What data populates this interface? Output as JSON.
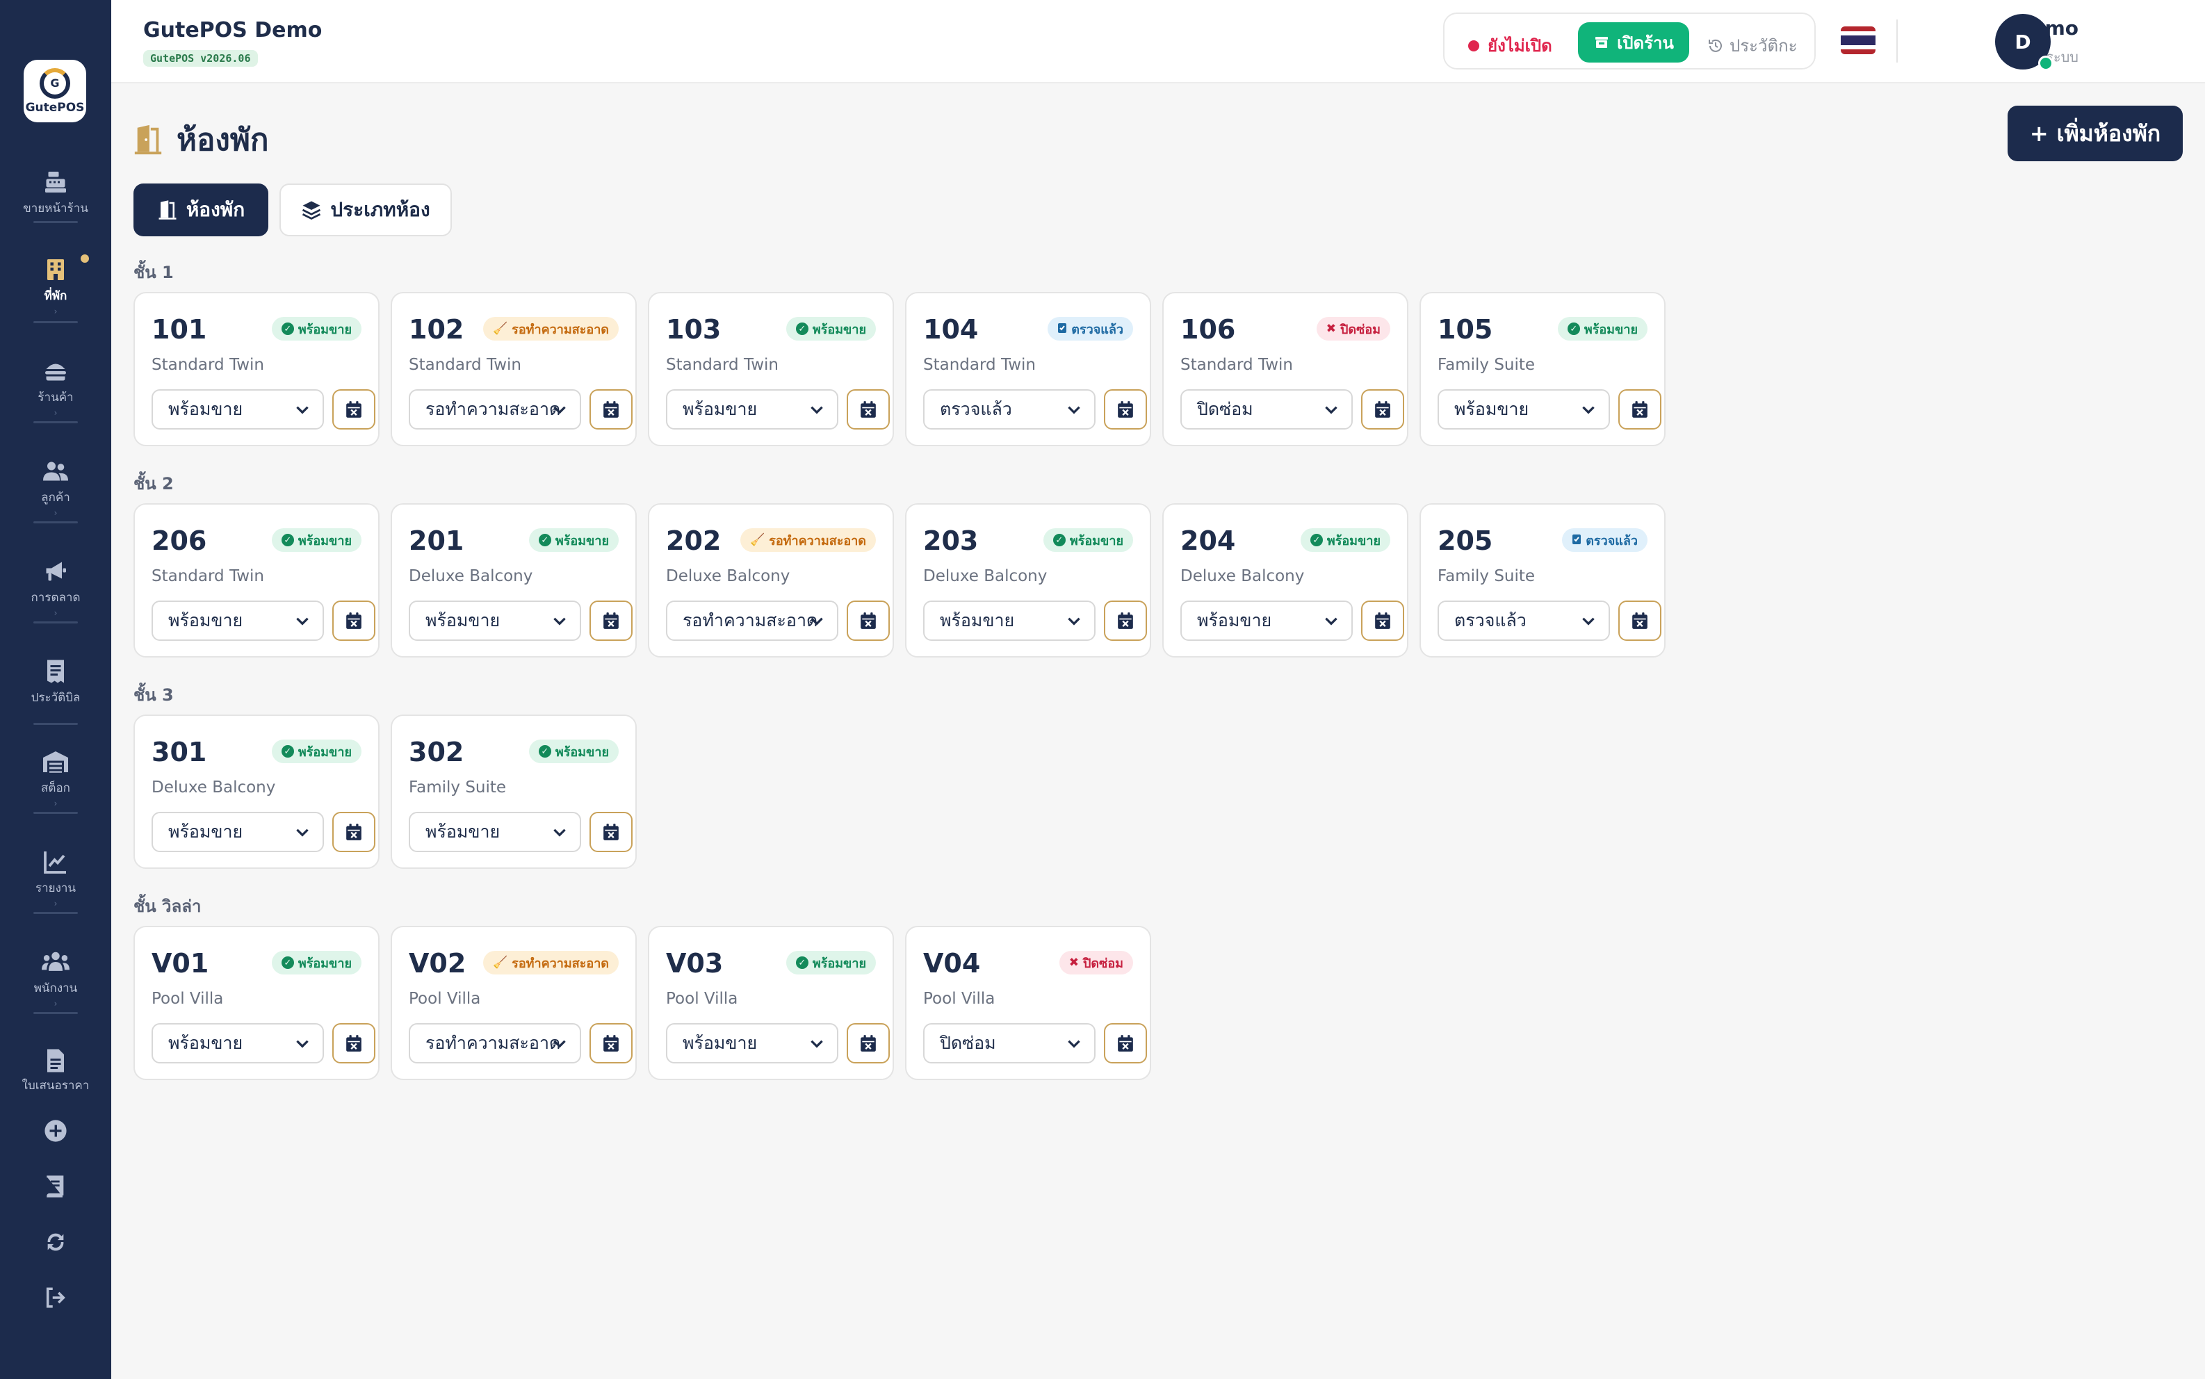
{
  "app": {
    "title": "GutePOS Demo",
    "version": "GutePOS v2026.06",
    "logo_text": "GutePOS"
  },
  "sidebar": {
    "items": [
      {
        "label": "ขายหน้าร้าน",
        "icon": "cash-register-icon",
        "active": false
      },
      {
        "label": "ที่พัก",
        "icon": "building-icon",
        "active": true
      },
      {
        "label": "ร้านค้า",
        "icon": "burger-icon",
        "active": false
      },
      {
        "label": "ลูกค้า",
        "icon": "users-icon",
        "active": false
      },
      {
        "label": "การตลาด",
        "icon": "megaphone-icon",
        "active": false
      },
      {
        "label": "ประวัติบิล",
        "icon": "receipt-icon",
        "active": false
      },
      {
        "label": "สต็อก",
        "icon": "warehouse-icon",
        "active": false
      },
      {
        "label": "รายงาน",
        "icon": "chart-line-icon",
        "active": false
      },
      {
        "label": "พนักงาน",
        "icon": "staff-icon",
        "active": false
      },
      {
        "label": "ใบเสนอราคา",
        "icon": "document-icon",
        "active": false
      }
    ],
    "bottom": [
      "plus-circle-icon",
      "book-icon",
      "sync-icon",
      "logout-icon"
    ]
  },
  "header": {
    "shop_status": "ยังไม่เปิด",
    "open_button": "เปิดร้าน",
    "history_button": "ประวัติกะ",
    "user_name": "Demo",
    "user_role": "ผู้ดูแลระบบ",
    "avatar_initial": "D"
  },
  "page": {
    "title": "ห้องพัก",
    "add_button": "เพิ่มห้องพัก",
    "tabs": [
      {
        "label": "ห้องพัก",
        "active": true
      },
      {
        "label": "ประเภทห้อง",
        "active": false
      }
    ]
  },
  "floors": [
    {
      "label": "ชั้น 1",
      "rooms": [
        {
          "number": "101",
          "type": "Standard Twin",
          "status": "พร้อมขาย",
          "kind": "ok",
          "select": "พร้อมขาย"
        },
        {
          "number": "102",
          "type": "Standard Twin",
          "status": "รอทำความสะอาด",
          "kind": "clean",
          "select": "รอทำความสะอาด"
        },
        {
          "number": "103",
          "type": "Standard Twin",
          "status": "พร้อมขาย",
          "kind": "ok",
          "select": "พร้อมขาย"
        },
        {
          "number": "104",
          "type": "Standard Twin",
          "status": "ตรวจแล้ว",
          "kind": "insp",
          "select": "ตรวจแล้ว"
        },
        {
          "number": "106",
          "type": "Standard Twin",
          "status": "ปิดซ่อม",
          "kind": "maint",
          "select": "ปิดซ่อม"
        },
        {
          "number": "105",
          "type": "Family Suite",
          "status": "พร้อมขาย",
          "kind": "ok",
          "select": "พร้อมขาย"
        }
      ]
    },
    {
      "label": "ชั้น 2",
      "rooms": [
        {
          "number": "206",
          "type": "Standard Twin",
          "status": "พร้อมขาย",
          "kind": "ok",
          "select": "พร้อมขาย"
        },
        {
          "number": "201",
          "type": "Deluxe Balcony",
          "status": "พร้อมขาย",
          "kind": "ok",
          "select": "พร้อมขาย"
        },
        {
          "number": "202",
          "type": "Deluxe Balcony",
          "status": "รอทำความสะอาด",
          "kind": "clean",
          "select": "รอทำความสะอาด"
        },
        {
          "number": "203",
          "type": "Deluxe Balcony",
          "status": "พร้อมขาย",
          "kind": "ok",
          "select": "พร้อมขาย"
        },
        {
          "number": "204",
          "type": "Deluxe Balcony",
          "status": "พร้อมขาย",
          "kind": "ok",
          "select": "พร้อมขาย"
        },
        {
          "number": "205",
          "type": "Family Suite",
          "status": "ตรวจแล้ว",
          "kind": "insp",
          "select": "ตรวจแล้ว"
        }
      ]
    },
    {
      "label": "ชั้น 3",
      "rooms": [
        {
          "number": "301",
          "type": "Deluxe Balcony",
          "status": "พร้อมขาย",
          "kind": "ok",
          "select": "พร้อมขาย"
        },
        {
          "number": "302",
          "type": "Family Suite",
          "status": "พร้อมขาย",
          "kind": "ok",
          "select": "พร้อมขาย"
        }
      ]
    },
    {
      "label": "ชั้น วิลล่า",
      "rooms": [
        {
          "number": "V01",
          "type": "Pool Villa",
          "status": "พร้อมขาย",
          "kind": "ok",
          "select": "พร้อมขาย"
        },
        {
          "number": "V02",
          "type": "Pool Villa",
          "status": "รอทำความสะอาด",
          "kind": "clean",
          "select": "รอทำความสะอาด"
        },
        {
          "number": "V03",
          "type": "Pool Villa",
          "status": "พร้อมขาย",
          "kind": "ok",
          "select": "พร้อมขาย"
        },
        {
          "number": "V04",
          "type": "Pool Villa",
          "status": "ปิดซ่อม",
          "kind": "maint",
          "select": "ปิดซ่อม"
        }
      ]
    }
  ],
  "colors": {
    "navy": "#1c2b4c",
    "green": "#10b47a",
    "red": "#e0264e",
    "gold": "#c9a25a"
  }
}
